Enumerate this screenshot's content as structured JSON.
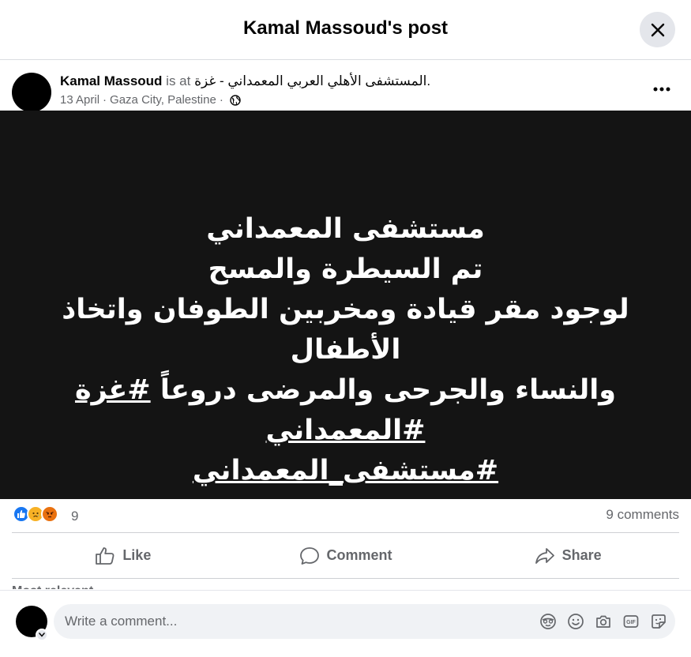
{
  "dialog": {
    "title": "Kamal Massoud's post"
  },
  "post": {
    "author": "Kamal Massoud",
    "is_at": "is at",
    "place": "المستشفى الأهلي العربي المعمداني - غزة.",
    "date": "13 April",
    "location": "Gaza City, Palestine",
    "privacy_icon": "globe-icon",
    "image_text": {
      "line1": "مستشفى المعمداني",
      "line2": "تم السيطرة والمسح",
      "line3": "لوجود مقر قيادة ومخربين الطوفان واتخاذ الأطفال",
      "line4_text": "والنساء والجرحى والمرضى دروعاً ",
      "line4_tag1": "#غزة",
      "line4_tag2": "#المعمداني",
      "line5_tag": "#مستشفى_المعمداني"
    }
  },
  "reactions": {
    "icons": [
      "like-icon",
      "sad-icon",
      "angry-icon"
    ],
    "count": "9",
    "comments": "9 comments"
  },
  "actions": {
    "like": "Like",
    "comment": "Comment",
    "share": "Share"
  },
  "sort": {
    "label": "Most relevant"
  },
  "composer": {
    "placeholder": "Write a comment...",
    "tools": [
      "avatar-sticker-icon",
      "emoji-icon",
      "camera-icon",
      "gif-icon",
      "sticker-icon"
    ]
  },
  "colors": {
    "accent": "#1877f2",
    "secondary_text": "#65676b",
    "divider": "#ced0d4",
    "image_background": "#141414"
  }
}
